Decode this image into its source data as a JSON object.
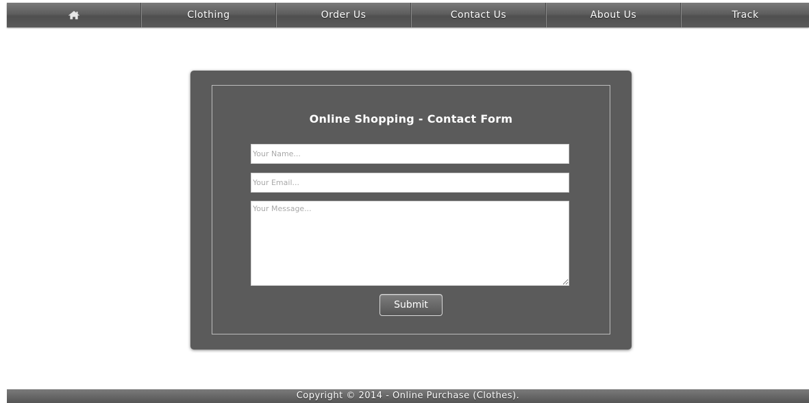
{
  "nav": {
    "home_icon": "home-icon",
    "items": [
      {
        "label": "Clothing"
      },
      {
        "label": "Order Us"
      },
      {
        "label": "Contact Us"
      },
      {
        "label": "About Us"
      },
      {
        "label": "Track"
      }
    ]
  },
  "form": {
    "title": "Online Shopping - Contact Form",
    "name_placeholder": "Your Name...",
    "email_placeholder": "Your Email...",
    "message_placeholder": "Your Message...",
    "submit_label": "Submit"
  },
  "footer": {
    "text": "Copyright © 2014 - Online Purchase (Clothes)."
  },
  "colors": {
    "nav_bg": "#5e5e5e",
    "card_bg": "#5b5b5b",
    "text_light": "#ffffff"
  }
}
